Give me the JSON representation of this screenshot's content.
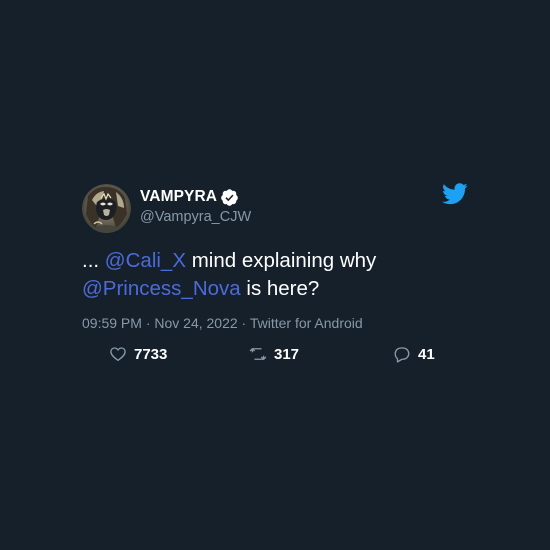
{
  "theme": {
    "background": "#15202b",
    "text_primary": "#ffffff",
    "text_secondary": "#8899a6",
    "mention_color": "#4d6bd8",
    "brand_blue": "#1da1f2"
  },
  "tweet": {
    "author": {
      "display_name": "VAMPYRA",
      "handle": "@Vampyra_CJW",
      "verified": true,
      "avatar_icon": "profile-avatar"
    },
    "brand_icon": "twitter-bird-icon",
    "text_parts": {
      "prefix": "... ",
      "mention_1": "@Cali_X",
      "middle": " mind explaining why ",
      "mention_2": "@Princess_Nova",
      "suffix": " is here?"
    },
    "meta": "09:59 PM · Nov 24, 2022 · Twitter for Android",
    "stats": {
      "likes": "7733",
      "retweets": "317",
      "replies": "41"
    }
  }
}
